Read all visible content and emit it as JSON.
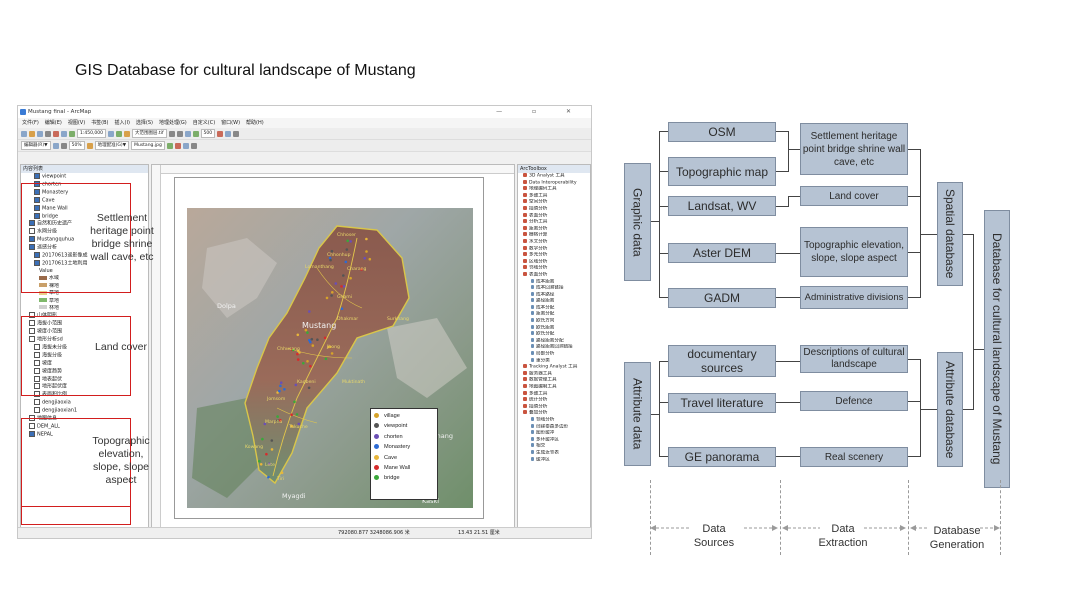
{
  "title": "GIS Database for cultural landscape of Mustang",
  "arcmap": {
    "window_title": "Mustang final - ArcMap",
    "window_buttons": "— ▫ ✕",
    "menu": [
      "文件(F)",
      "编辑(E)",
      "视图(V)",
      "书签(B)",
      "插入(I)",
      "选择(S)",
      "地理处理(G)",
      "自定义(C)",
      "窗口(W)",
      "帮助(H)"
    ],
    "scale": "1:450,000",
    "toolbar_fields": [
      "大范围图层.tif",
      "500",
      "Mustang.jpg",
      "50%"
    ],
    "layer_dropdowns": [
      "编辑器(R)▼",
      "地理配准(G)▼"
    ],
    "toc_title": "内容列表",
    "toc_items": [
      {
        "label": "viewpoint",
        "checked": true,
        "indent": 2
      },
      {
        "label": "chorten",
        "checked": true,
        "indent": 2
      },
      {
        "label": "Monastery",
        "checked": true,
        "indent": 2
      },
      {
        "label": "Cave",
        "checked": true,
        "indent": 2
      },
      {
        "label": "Mane Wall",
        "checked": true,
        "indent": 2
      },
      {
        "label": "bridge",
        "checked": true,
        "indent": 2
      },
      {
        "label": "自然和历史遗产",
        "checked": true,
        "indent": 1
      },
      {
        "label": "水网分级",
        "checked": false,
        "indent": 1
      },
      {
        "label": "Mustangquhua",
        "checked": true,
        "indent": 1
      },
      {
        "label": "遥感分析",
        "checked": true,
        "indent": 1
      },
      {
        "label": "20170613遥影像成",
        "checked": true,
        "indent": 2
      },
      {
        "label": "20170613土地利用",
        "checked": true,
        "indent": 2
      },
      {
        "label": "Value",
        "checked": null,
        "indent": 3
      },
      {
        "label": "水域",
        "checked": null,
        "indent": 3,
        "swatch": "#9a6a4a"
      },
      {
        "label": "裸地",
        "checked": null,
        "indent": 3,
        "swatch": "#c9a06a"
      },
      {
        "label": "草地",
        "checked": null,
        "indent": 3,
        "swatch": "#e8d08a"
      },
      {
        "label": "草地",
        "checked": null,
        "indent": 3,
        "swatch": "#7fb86b"
      },
      {
        "label": "林地",
        "checked": null,
        "indent": 3,
        "swatch": "#cfcfcf"
      },
      {
        "label": "山体阴影",
        "checked": false,
        "indent": 1
      },
      {
        "label": "海拔小范围",
        "checked": false,
        "indent": 1
      },
      {
        "label": "坡度小范围",
        "checked": false,
        "indent": 1
      },
      {
        "label": "地形分析sd",
        "checked": false,
        "indent": 1
      },
      {
        "label": "海拔未分级",
        "checked": false,
        "indent": 2
      },
      {
        "label": "海拔分级",
        "checked": false,
        "indent": 2
      },
      {
        "label": "坡度",
        "checked": false,
        "indent": 2
      },
      {
        "label": "坡度趋势",
        "checked": false,
        "indent": 2
      },
      {
        "label": "地表起伏",
        "checked": false,
        "indent": 2
      },
      {
        "label": "地形起伏度",
        "checked": false,
        "indent": 2
      },
      {
        "label": "表面积比例",
        "checked": false,
        "indent": 2
      },
      {
        "label": "dengjiaoxia",
        "checked": false,
        "indent": 2
      },
      {
        "label": "dengjiaoxian1",
        "checked": false,
        "indent": 2
      },
      {
        "label": "地图信息",
        "checked": false,
        "indent": 1
      },
      {
        "label": "DEM_ALL",
        "checked": false,
        "indent": 1
      },
      {
        "label": "NEPAL",
        "checked": true,
        "indent": 1
      }
    ],
    "annotations": [
      "Settlement heritage point bridge shrine wall cave, etc",
      "Land cover",
      "Topographic elevation, slope, slope aspect"
    ],
    "map_labels": [
      "Dolpa",
      "Mustang",
      "Myagdi",
      "Kaski",
      "Manang",
      "Chhoser",
      "Lomanthang",
      "Charang",
      "Chhonhup",
      "Ghami",
      "Surkhang",
      "Dhakmar",
      "Chhusang",
      "Jhong",
      "Muktinath",
      "Kagbeni",
      "Jomsom",
      "Marpha",
      "Tukuche",
      "Kowang",
      "Lete",
      "Tiri"
    ],
    "legend": [
      {
        "label": "village",
        "color": "#d6a32a"
      },
      {
        "label": "viewpoint",
        "color": "#555555"
      },
      {
        "label": "chorten",
        "color": "#6b4fb5"
      },
      {
        "label": "Monastery",
        "color": "#2d6bd4"
      },
      {
        "label": "Cave",
        "color": "#e8b63a"
      },
      {
        "label": "Mane Wall",
        "color": "#d62c2c"
      },
      {
        "label": "bridge",
        "color": "#3aa83a"
      }
    ],
    "arctoolbox_title": "ArcToolbox",
    "arctoolbox_items": [
      "3D Analyst 工具",
      "Data Interoperability",
      "地理编码工具",
      "多维工具",
      "空间分析",
      "插值分析",
      "表面分析",
      "分析工具",
      "距离分析",
      "栅格计算",
      "水文分析",
      "数学分析",
      "多元分析",
      "区域分析",
      "邻域分析",
      "表面分析",
      "成本距离",
      "成本回溯链接",
      "成本路径",
      "路径距离",
      "成本分配",
      "距离分配",
      "欧氏方向",
      "欧氏距离",
      "欧氏分配",
      "路径距离分配",
      "路径距离回溯链接",
      "局部分析",
      "重分类",
      "Tracking Analyst 工具",
      "服务器工具",
      "数据管理工具",
      "地图编制工具",
      "多维工具",
      "统计分析",
      "插值分析",
      "叠加分析",
      "领域分析",
      "创建泰森多边形",
      "图形缓冲",
      "多环缓冲区",
      "相交",
      "生成近邻表",
      "缓冲区"
    ],
    "status": "792080.877  3248086.906 米",
    "status_right": "13.43  21.51 厘米"
  },
  "diagram": {
    "graphic_label": "Graphic data",
    "attribute_label": "Attribute data",
    "sources_graphic": [
      "OSM",
      "Topographic map",
      "Landsat, WV",
      "Aster DEM",
      "GADM"
    ],
    "sources_attribute": [
      "documentary sources",
      "Travel literature",
      "GE panorama"
    ],
    "extracted_graphic": [
      "Settlement heritage point bridge shrine wall cave, etc",
      "Land cover",
      "Topographic elevation, slope, slope aspect",
      "Administrative divisions"
    ],
    "extracted_attribute": [
      "Descriptions of cultural landscape",
      "Defence",
      "Real scenery"
    ],
    "spatial_db": "Spatial database",
    "attribute_db": "Attribute database",
    "final_db": "Database for cultural landscape of Mustang",
    "stages": [
      "Data Sources",
      "Data Extraction",
      "Database Generation"
    ]
  }
}
